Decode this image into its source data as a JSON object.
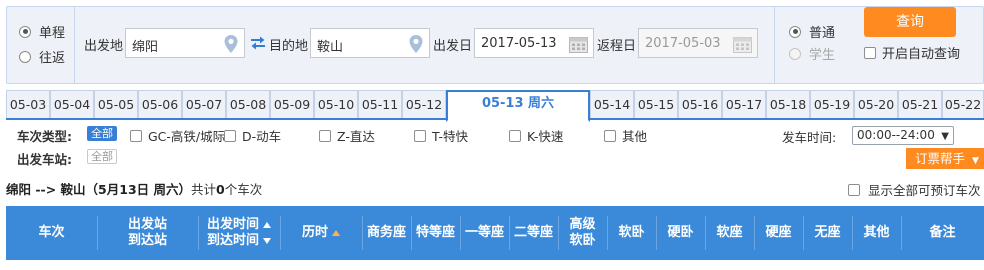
{
  "trip_type": {
    "options": [
      {
        "label": "单程",
        "selected": true
      },
      {
        "label": "往返",
        "selected": false
      }
    ]
  },
  "search": {
    "from_label": "出发地",
    "from_value": "绵阳",
    "to_label": "目的地",
    "to_value": "鞍山",
    "depart_label": "出发日",
    "depart_value": "2017-05-13",
    "return_label": "返程日",
    "return_value": "2017-05-03"
  },
  "passenger_type": {
    "options": [
      {
        "label": "普通",
        "selected": true,
        "disabled": false
      },
      {
        "label": "学生",
        "selected": false,
        "disabled": true
      }
    ]
  },
  "actions": {
    "query_label": "查询",
    "auto_query_label": "开启自动查询"
  },
  "date_tabs": [
    {
      "label": "05-03"
    },
    {
      "label": "05-04"
    },
    {
      "label": "05-05"
    },
    {
      "label": "05-06"
    },
    {
      "label": "05-07"
    },
    {
      "label": "05-08"
    },
    {
      "label": "05-09"
    },
    {
      "label": "05-10"
    },
    {
      "label": "05-11"
    },
    {
      "label": "05-12"
    },
    {
      "label": "05-13 周六",
      "active": true
    },
    {
      "label": "05-14"
    },
    {
      "label": "05-15"
    },
    {
      "label": "05-16"
    },
    {
      "label": "05-17"
    },
    {
      "label": "05-18"
    },
    {
      "label": "05-19"
    },
    {
      "label": "05-20"
    },
    {
      "label": "05-21"
    },
    {
      "label": "05-22"
    }
  ],
  "filters": {
    "train_type_label": "车次类型:",
    "all_label": "全部",
    "train_types": [
      "GC-高铁/城际",
      "D-动车",
      "Z-直达",
      "T-特快",
      "K-快速",
      "其他"
    ],
    "station_label": "出发车站:",
    "station_all_label": "全部",
    "depart_time_label": "发车时间:",
    "depart_time_value": "00:00--24:00",
    "helper_label": "订票帮手"
  },
  "summary": {
    "route": "绵阳 --> 鞍山（5月13日  周六）",
    "count_prefix": "共计",
    "count": "0",
    "count_suffix": "个车次",
    "show_all_label": "显示全部可预订车次"
  },
  "table_headers": {
    "train_no": "车次",
    "from_station": "出发站",
    "to_station": "到达站",
    "depart_time": "出发时间",
    "arrive_time": "到达时间",
    "duration": "历时",
    "business": "商务座",
    "premium": "特等座",
    "first": "一等座",
    "second": "二等座",
    "deluxe_1": "高级",
    "deluxe_2": "软卧",
    "soft_sleeper": "软卧",
    "hard_sleeper": "硬卧",
    "soft_seat": "软座",
    "hard_seat": "硬座",
    "no_seat": "无座",
    "other": "其他",
    "remark": "备注"
  },
  "colors": {
    "accent_blue": "#3b8ad9",
    "action_orange": "#ff8a1f",
    "panel_bg": "#eef1f8"
  }
}
